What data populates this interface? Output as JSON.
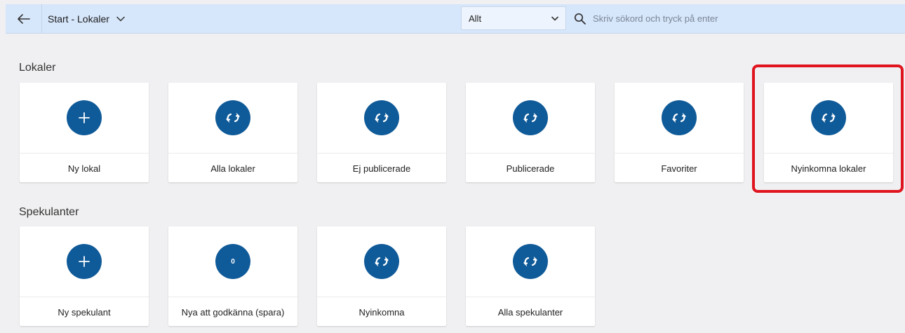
{
  "header": {
    "back_icon": "arrow-left-icon",
    "breadcrumb": "Start - Lokaler",
    "scope_value": "Allt",
    "search_placeholder": "Skriv sökord och tryck på enter"
  },
  "sections": {
    "lokaler": {
      "title": "Lokaler",
      "cards": [
        {
          "label": "Ny lokal",
          "icon": "plus-icon"
        },
        {
          "label": "Alla lokaler",
          "icon": "refresh-icon"
        },
        {
          "label": "Ej publicerade",
          "icon": "refresh-icon"
        },
        {
          "label": "Publicerade",
          "icon": "refresh-icon"
        },
        {
          "label": "Favoriter",
          "icon": "refresh-icon"
        },
        {
          "label": "Nyinkomna lokaler",
          "icon": "refresh-icon"
        }
      ]
    },
    "spekulanter": {
      "title": "Spekulanter",
      "cards": [
        {
          "label": "Ny spekulant",
          "icon": "plus-icon"
        },
        {
          "label": "Nya att godkänna (spara)",
          "icon": "count-badge",
          "count": "0"
        },
        {
          "label": "Nyinkomna",
          "icon": "refresh-icon"
        },
        {
          "label": "Alla spekulanter",
          "icon": "refresh-icon"
        }
      ]
    }
  },
  "colors": {
    "topbar": "#d6e6fb",
    "accent_circle": "#0f5a98",
    "highlight": "#e0141e",
    "background": "#f0f0f2"
  }
}
